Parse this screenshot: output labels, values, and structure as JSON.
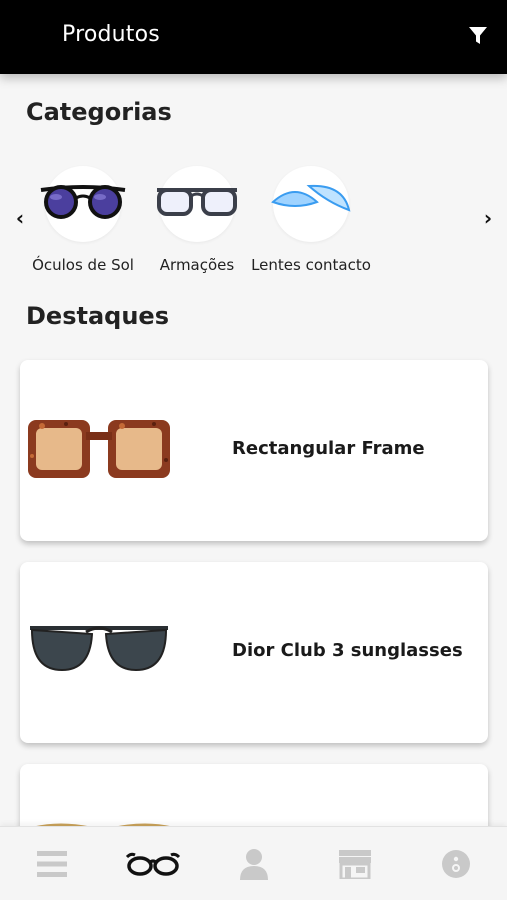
{
  "header": {
    "title": "Produtos",
    "filter_icon": "filter-icon",
    "background": "#000000"
  },
  "categories": {
    "title": "Categorias",
    "prev_icon": "chevron-left-icon",
    "next_icon": "chevron-right-icon",
    "items": [
      {
        "label": "Óculos de Sol",
        "icon": "sunglasses-image"
      },
      {
        "label": "Armações",
        "icon": "eyeglass-frames-image"
      },
      {
        "label": "Lentes contacto",
        "icon": "contact-lenses-image"
      }
    ]
  },
  "highlights": {
    "title": "Destaques",
    "products": [
      {
        "name": "Rectangular Frame",
        "image": "tortoiseshell-square-sunglasses"
      },
      {
        "name": "Dior Club 3 sunglasses",
        "image": "dark-aviator-sunglasses"
      },
      {
        "name": "",
        "image": "gold-frame-glasses"
      }
    ]
  },
  "bottom_nav": {
    "items": [
      {
        "icon": "menu-icon",
        "active": false
      },
      {
        "icon": "glasses-icon",
        "active": true
      },
      {
        "icon": "user-icon",
        "active": false
      },
      {
        "icon": "store-icon",
        "active": false
      },
      {
        "icon": "info-icon",
        "active": false
      }
    ],
    "active_color": "#111111",
    "inactive_color": "#c9c9c9"
  }
}
